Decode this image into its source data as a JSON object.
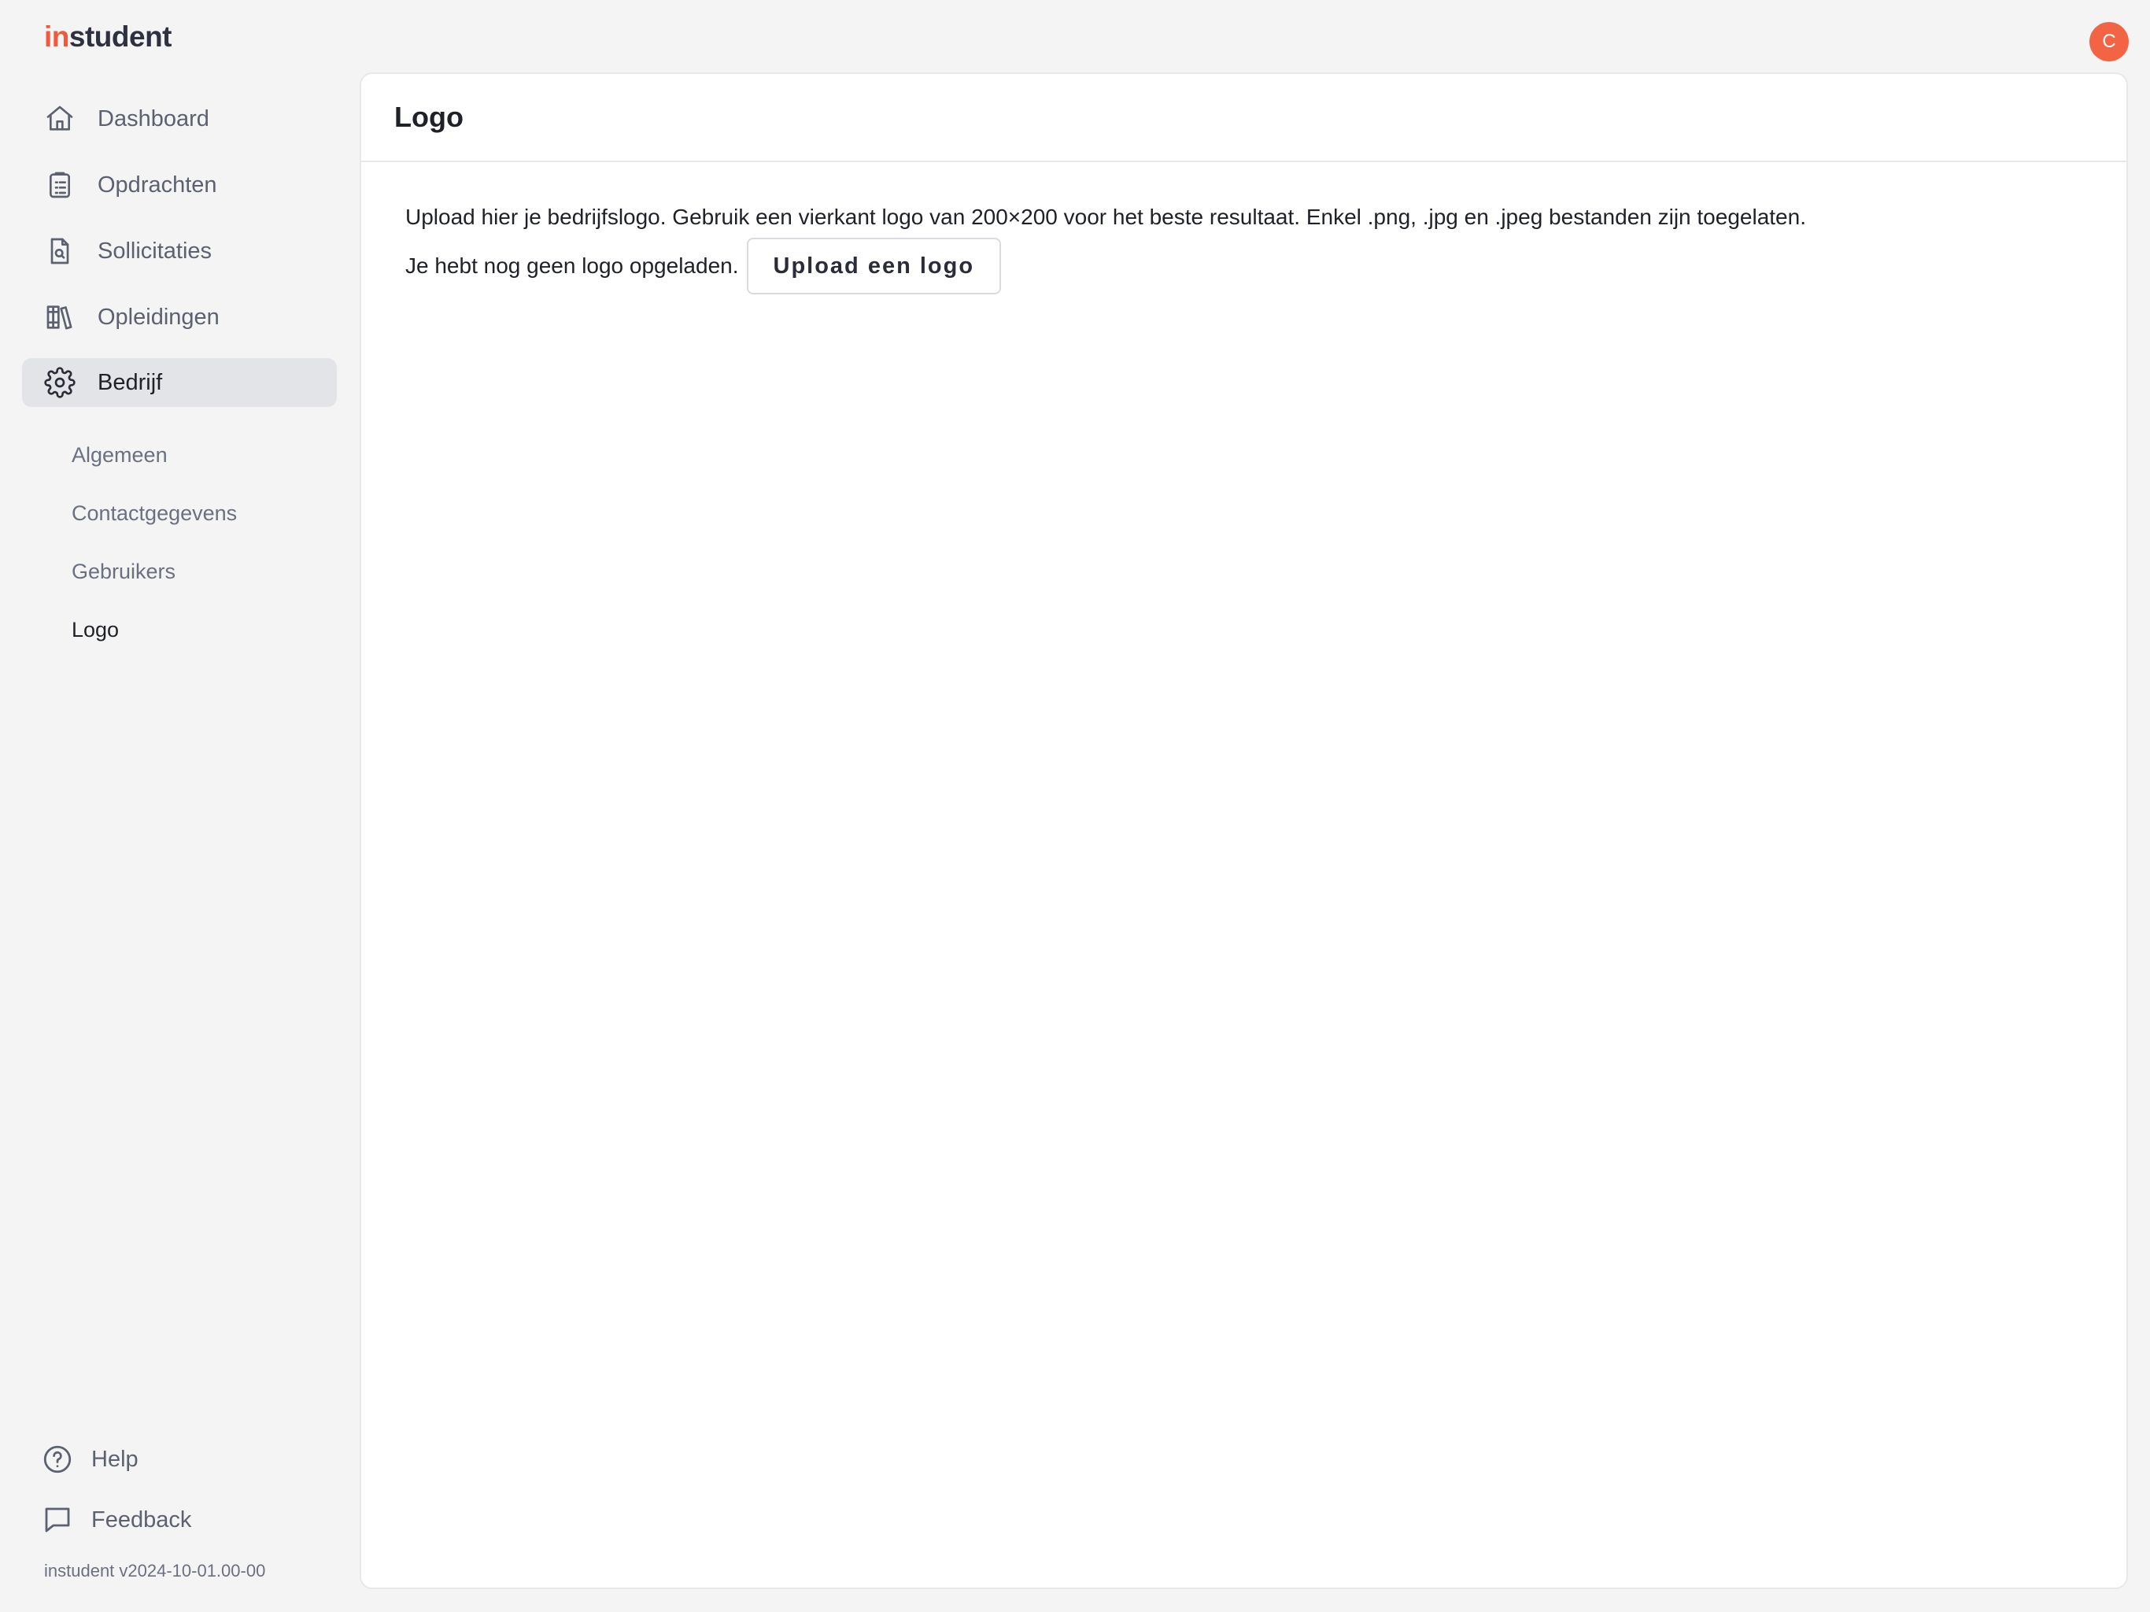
{
  "app": {
    "brand_prefix": "in",
    "brand_suffix": "student",
    "avatar_initial": "C",
    "version": "instudent v2024-10-01.00-00"
  },
  "sidebar": {
    "items": [
      {
        "label": "Dashboard",
        "icon": "home-icon"
      },
      {
        "label": "Opdrachten",
        "icon": "clipboard-icon"
      },
      {
        "label": "Sollicitaties",
        "icon": "document-search-icon"
      },
      {
        "label": "Opleidingen",
        "icon": "books-icon"
      },
      {
        "label": "Bedrijf",
        "icon": "gear-icon",
        "active": true
      }
    ],
    "subitems": [
      {
        "label": "Algemeen"
      },
      {
        "label": "Contactgegevens"
      },
      {
        "label": "Gebruikers"
      },
      {
        "label": "Logo",
        "active": true
      }
    ],
    "footer": [
      {
        "label": "Help",
        "icon": "help-circle-icon"
      },
      {
        "label": "Feedback",
        "icon": "chat-bubble-icon"
      }
    ]
  },
  "main": {
    "title": "Logo",
    "description": "Upload hier je bedrijfslogo. Gebruik een vierkant logo van 200×200 voor het beste resultaat. Enkel .png, .jpg en .jpeg bestanden zijn toegelaten.",
    "status": "Je hebt nog geen logo opgeladen.",
    "upload_label": "Upload een logo"
  },
  "colors": {
    "accent": "#f05a3c",
    "avatar": "#f26444",
    "active_bg": "#e3e4e8",
    "page_bg": "#f4f4f5"
  }
}
